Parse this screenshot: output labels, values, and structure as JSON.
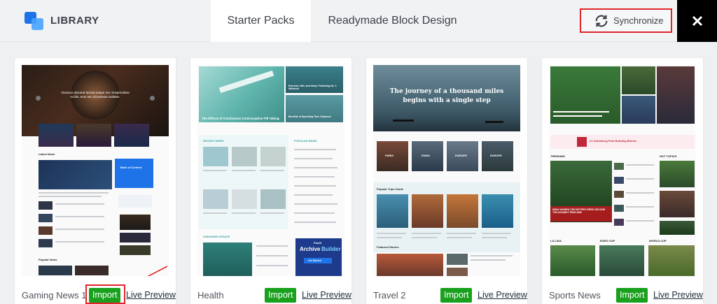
{
  "header": {
    "library_label": "LIBRARY",
    "tabs": [
      {
        "label": "Starter Packs",
        "active": true
      },
      {
        "label": "Readymade Block Design",
        "active": false
      }
    ],
    "sync_label": "Synchronize",
    "close_symbol": "✕"
  },
  "colors": {
    "import_green": "#19a11e",
    "highlight_red": "#e0262a",
    "accent_blue": "#1e73e8"
  },
  "cards": [
    {
      "title": "Gaming News 1",
      "import_label": "Import",
      "preview_label": "Live Preview",
      "thumb": {
        "hero_caption": "Vivamus placerat lacinia neque nec Suspendisse mollis, eros nec accumsan sodales.",
        "section_latest": "Latest News",
        "toc_title": "Table of Content",
        "section_popular": "Popular News"
      }
    },
    {
      "title": "Health",
      "import_label": "Import",
      "preview_label": "Live Preview",
      "thumb": {
        "hero_caption": "The Effects of Continuous Contraceptive Pill Taking",
        "side_caption_1": "Exercise, diet, and sleep: Following No. 1 Wellness",
        "side_caption_2": "Benefits of Spending Time Outdoors",
        "section_recent": "RECENT NEWS",
        "section_popular": "POPULAR NEWS",
        "section_unknown": "UNKNOWN UPDATE",
        "ad_brand": "PostX",
        "ad_line1": "Archive",
        "ad_line2": "Builder",
        "ad_button": "Get Started"
      }
    },
    {
      "title": "Travel 2",
      "import_label": "Import",
      "preview_label": "Live Preview",
      "thumb": {
        "hero_line1": "The journey of a thousand miles",
        "hero_line2": "begins with a single step",
        "destinations": [
          "PARIS",
          "PARIS",
          "EUROPE",
          "EUROPE"
        ],
        "section_popular": "Popular Trips Guide",
        "section_featured": "Featured Stories"
      }
    },
    {
      "title": "Sports News",
      "import_label": "Import",
      "preview_label": "Live Preview",
      "thumb": {
        "banner_text": "#1 Gutenberg Post Building Blocks.",
        "section_trending": "TRENDING",
        "section_hot": "HOT TOPICS",
        "headline": "INDIA WOMEN CRICKETERS FIRED SECOND T20I AGAINST ENGLAND",
        "sections_bottom": [
          "LA LIGA",
          "EURO CUP",
          "WORLD CUP"
        ]
      }
    }
  ]
}
